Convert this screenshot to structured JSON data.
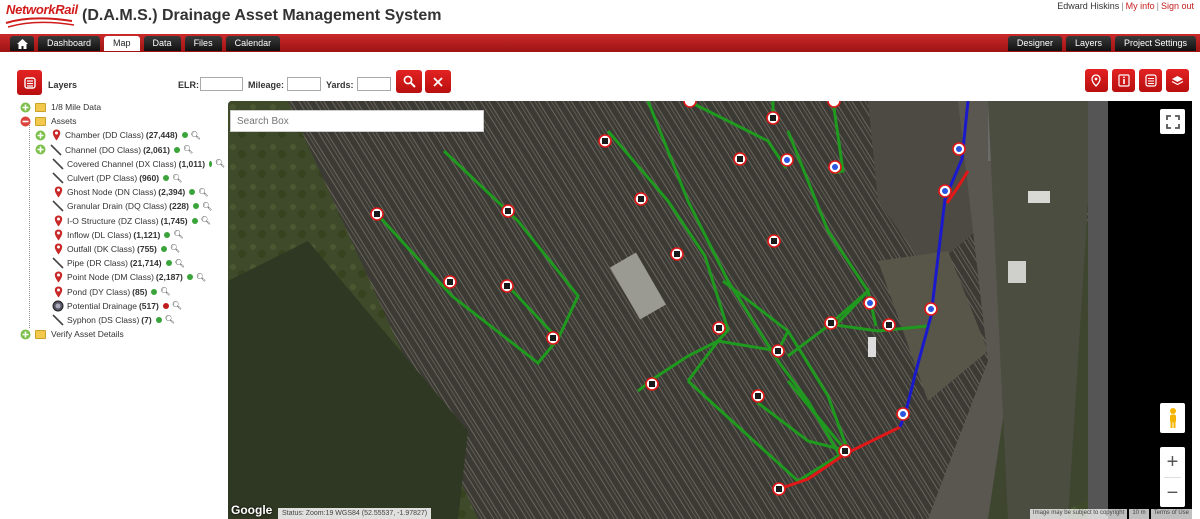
{
  "header": {
    "logo_text": "NetworkRail",
    "title": "(D.A.M.S.) Drainage Asset Management System",
    "user_name": "Edward Hiskins",
    "my_info": "My info",
    "sign_out": "Sign out"
  },
  "nav": {
    "tabs": [
      {
        "label": "Dashboard"
      },
      {
        "label": "Map",
        "active": true
      },
      {
        "label": "Data"
      },
      {
        "label": "Files"
      },
      {
        "label": "Calendar"
      }
    ],
    "right_tabs": [
      {
        "label": "Designer"
      },
      {
        "label": "Layers"
      },
      {
        "label": "Project Settings"
      }
    ]
  },
  "toolbar": {
    "layers_label": "Layers",
    "elr_label": "ELR:",
    "mileage_label": "Mileage:",
    "yards_label": "Yards:",
    "elr_value": "",
    "mileage_value": "",
    "yards_value": ""
  },
  "tree": {
    "mile_data": "1/8 Mile Data",
    "assets": "Assets",
    "items": [
      {
        "label": "Chamber (DD Class)",
        "count": "(27,448)",
        "icon": "pin-icon",
        "expandable": true,
        "dot": "green"
      },
      {
        "label": "Channel (DO Class)",
        "count": "(2,061)",
        "icon": "line-icon",
        "expandable": true,
        "dot": "green"
      },
      {
        "label": "Covered Channel (DX Class)",
        "count": "(1,011)",
        "icon": "line-icon",
        "dot": "green"
      },
      {
        "label": "Culvert (DP Class)",
        "count": "(960)",
        "icon": "line-icon",
        "dot": "green"
      },
      {
        "label": "Ghost Node (DN Class)",
        "count": "(2,394)",
        "icon": "pin-icon",
        "dot": "green"
      },
      {
        "label": "Granular Drain (DQ Class)",
        "count": "(228)",
        "icon": "line-icon",
        "dot": "green"
      },
      {
        "label": "I-O Structure (DZ Class)",
        "count": "(1,745)",
        "icon": "pin-icon",
        "dot": "green"
      },
      {
        "label": "Inflow (DL Class)",
        "count": "(1,121)",
        "icon": "pin-icon",
        "dot": "green"
      },
      {
        "label": "Outfall (DK Class)",
        "count": "(755)",
        "icon": "pin-icon",
        "dot": "green"
      },
      {
        "label": "Pipe (DR Class)",
        "count": "(21,714)",
        "icon": "line-icon",
        "dot": "green"
      },
      {
        "label": "Point Node (DM Class)",
        "count": "(2,187)",
        "icon": "pin-icon",
        "dot": "green"
      },
      {
        "label": "Pond (DY Class)",
        "count": "(85)",
        "icon": "pin-icon",
        "dot": "green"
      },
      {
        "label": "Potential Drainage",
        "count": "(517)",
        "icon": "drain-icon",
        "dot": "red"
      },
      {
        "label": "Syphon (DS Class)",
        "count": "(7)",
        "icon": "line-icon",
        "dot": "green"
      }
    ],
    "verify": "Verify Asset Details"
  },
  "map": {
    "search_placeholder": "Search Box",
    "status": "Status:  Zoom:19 WGS84 (52.55537, -1.97827)",
    "imagery_note": "Image may be subject to copyright",
    "scale": "10 m",
    "terms": "Terms of Use",
    "google": "Google",
    "zoom_in": "+",
    "zoom_out": "−"
  },
  "colors": {
    "brand_red": "#c41e1e",
    "pipe_green": "#1f9a1f",
    "pipe_red": "#e01818",
    "pipe_blue": "#1a1acc"
  }
}
